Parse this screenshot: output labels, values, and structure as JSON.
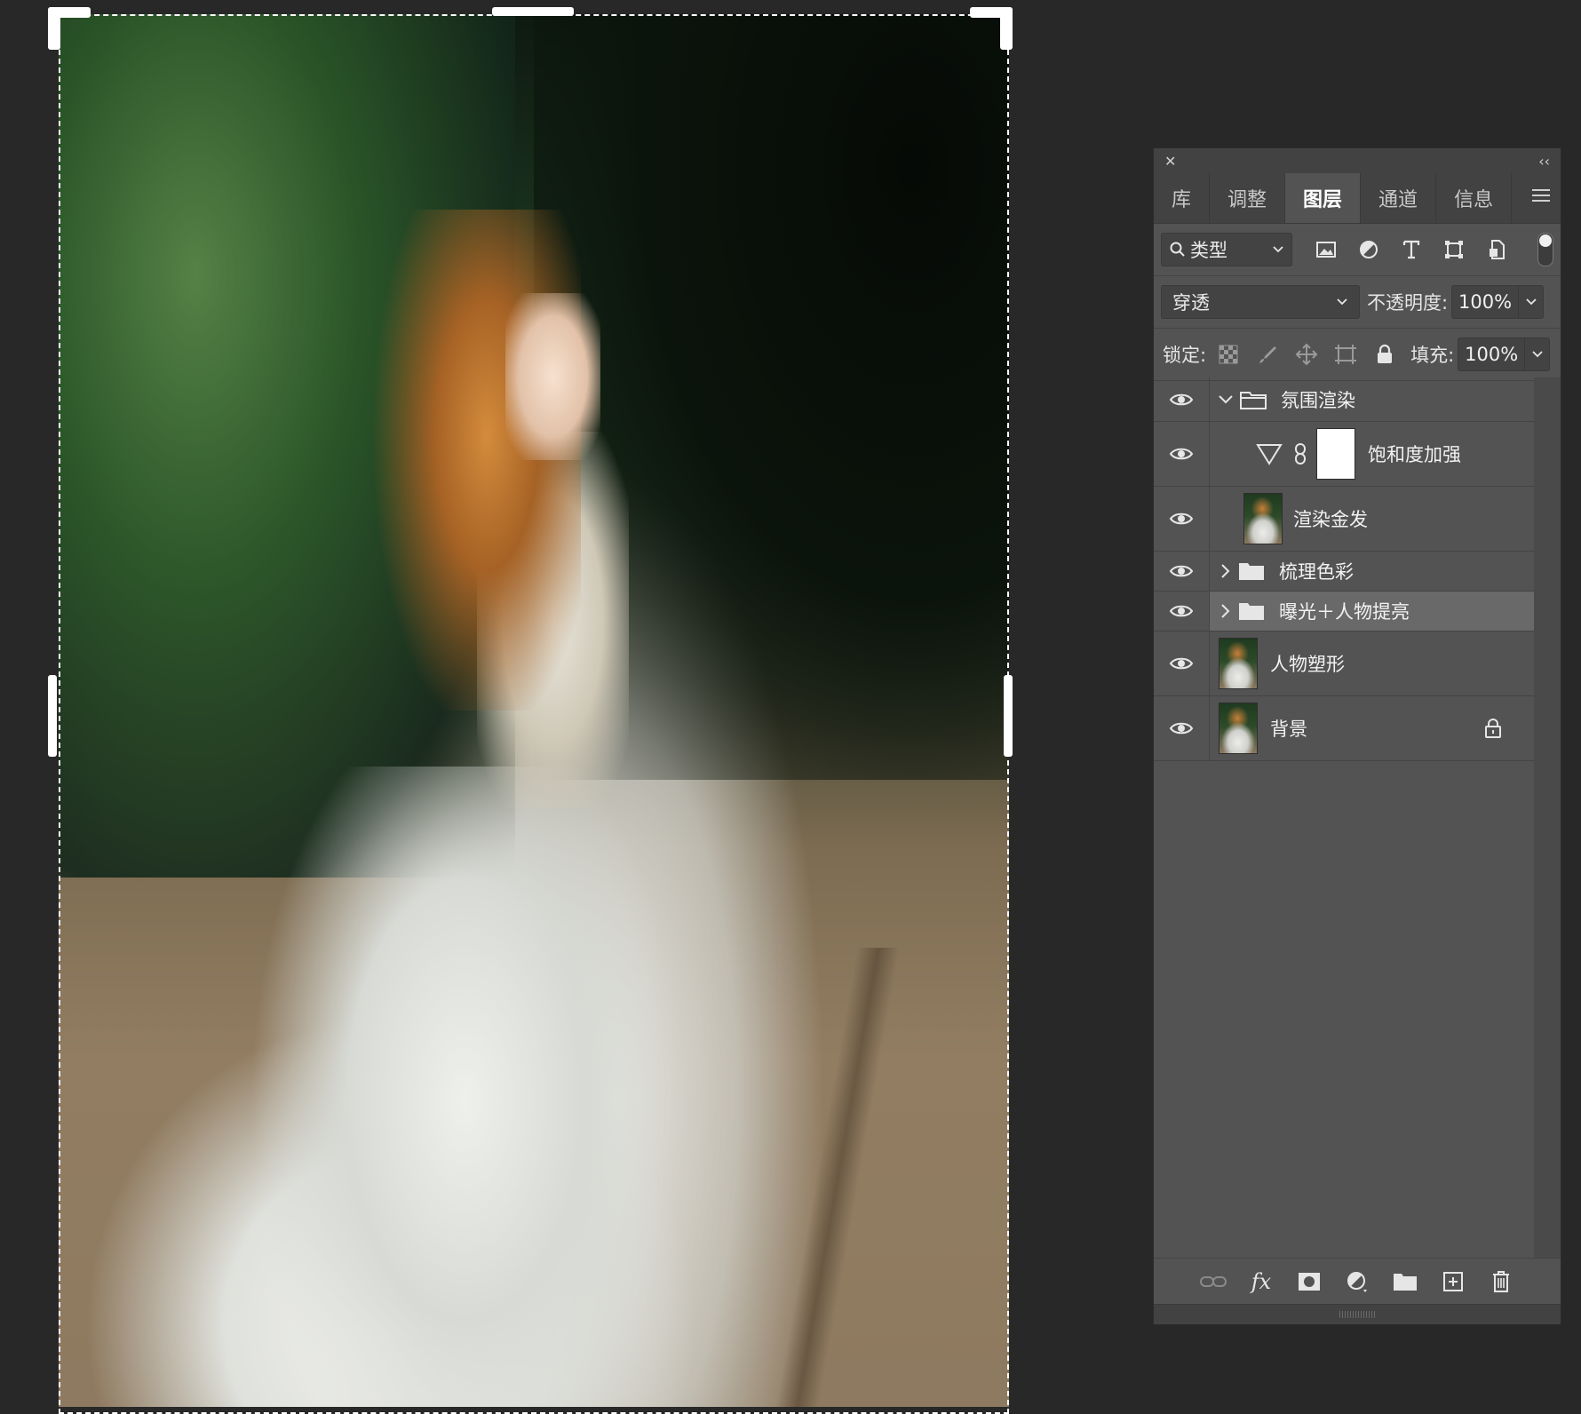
{
  "canvas": {
    "description_free": ""
  },
  "panel": {
    "close_glyph": "✕",
    "collapse_glyph": "‹‹",
    "tabs": [
      {
        "label": "库",
        "active": false
      },
      {
        "label": "调整",
        "active": false
      },
      {
        "label": "图层",
        "active": true
      },
      {
        "label": "通道",
        "active": false
      },
      {
        "label": "信息",
        "active": false
      }
    ],
    "filter": {
      "kind_label": "类型",
      "icons": [
        "image-filter-icon",
        "adjustment-filter-icon",
        "type-filter-icon",
        "shape-filter-icon",
        "smart-object-filter-icon"
      ]
    },
    "blend": {
      "mode": "穿透",
      "opacity_label": "不透明度:",
      "opacity_value": "100%"
    },
    "lock": {
      "label": "锁定:",
      "icons": [
        "lock-transparent-pixels-icon",
        "lock-image-pixels-icon",
        "lock-position-icon",
        "lock-artboard-icon",
        "lock-all-icon"
      ],
      "fill_label": "填充:",
      "fill_value": "100%"
    },
    "layers": [
      {
        "name": "氛围渲染",
        "type": "group",
        "expanded": true,
        "visible": true,
        "selected": false,
        "indent": 0
      },
      {
        "name": "饱和度加强",
        "type": "adjustment",
        "visible": true,
        "selected": false,
        "indent": 1
      },
      {
        "name": "渲染金发",
        "type": "pixel",
        "visible": true,
        "selected": false,
        "indent": 1
      },
      {
        "name": "梳理色彩",
        "type": "group",
        "expanded": false,
        "visible": true,
        "selected": false,
        "indent": 0
      },
      {
        "name": "曝光＋人物提亮",
        "type": "group",
        "expanded": false,
        "visible": true,
        "selected": true,
        "indent": 0
      },
      {
        "name": "人物塑形",
        "type": "pixel",
        "visible": true,
        "selected": false,
        "indent": 0
      },
      {
        "name": "背景",
        "type": "pixel",
        "visible": true,
        "selected": false,
        "locked": true,
        "indent": 0
      }
    ],
    "bottom_icons": [
      "link-layers-icon",
      "fx-icon",
      "add-mask-icon",
      "new-adjustment-icon",
      "new-group-icon",
      "new-layer-icon",
      "delete-layer-icon"
    ],
    "fx_label": "fx"
  }
}
